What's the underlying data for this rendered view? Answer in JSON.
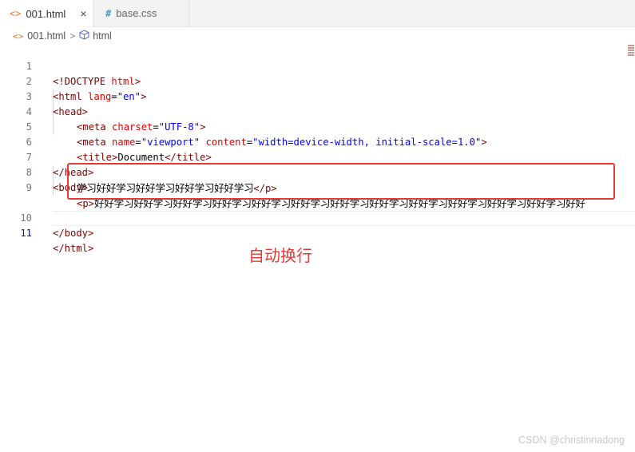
{
  "tabs": [
    {
      "icon": "<>",
      "label": "001.html",
      "close": "×",
      "active": true
    },
    {
      "icon": "#",
      "label": "base.css",
      "active": false
    }
  ],
  "breadcrumb": {
    "file": "001.html",
    "separator": ">",
    "element": "html"
  },
  "code": {
    "line_numbers": [
      "1",
      "2",
      "3",
      "4",
      "5",
      "6",
      "7",
      "8",
      "9",
      "10",
      "11"
    ],
    "l1": {
      "a": "<!DOCTYPE ",
      "b": "html",
      "c": ">"
    },
    "l2": {
      "a": "<html ",
      "b": "lang",
      "c": "=",
      "d": "\"en\"",
      "e": ">"
    },
    "l3": {
      "a": "<head>"
    },
    "l4": {
      "a": "<meta ",
      "b": "charset",
      "c": "=",
      "d": "\"UTF-8\"",
      "e": ">"
    },
    "l5": {
      "a": "<meta ",
      "b": "name",
      "c": "=",
      "d": "\"viewport\"",
      "e": " content",
      "f": "=",
      "g": "\"width=device-width, initial-scale=1.0\"",
      "h": ">"
    },
    "l6": {
      "a": "<title>",
      "b": "Document",
      "c": "</title>"
    },
    "l7": {
      "a": "</head>"
    },
    "l8": {
      "a": "<body>"
    },
    "l9": {
      "a": "<p>",
      "b": "好好学习好好学习好好学习好好学习好好学习好好学习好好学习好好学习好好学习好好学习好好学习好好学习好好",
      "c": "学习好好学习好好学习好好学习好好学习",
      "d": "</p>"
    },
    "l10": {
      "a": "</body>"
    },
    "l11": {
      "a": "</html>"
    }
  },
  "annotation": "自动换行",
  "watermark": "CSDN @christinnadong"
}
